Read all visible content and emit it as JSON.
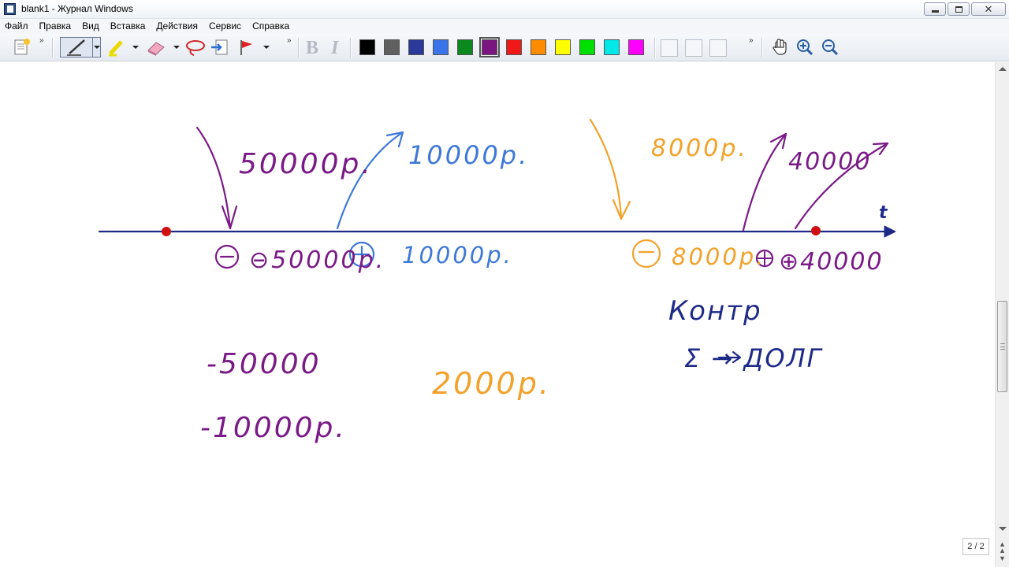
{
  "window": {
    "title": "blank1 - Журнал Windows"
  },
  "menu": [
    "Файл",
    "Правка",
    "Вид",
    "Вставка",
    "Действия",
    "Сервис",
    "Справка"
  ],
  "toolbar": {
    "bold_label": "B",
    "italic_label": "I",
    "colors": [
      "#000000",
      "#606060",
      "#2b3a9b",
      "#3b74e8",
      "#0a8a1e",
      "#7b1580",
      "#f01818",
      "#ff8c00",
      "#ffff00",
      "#00e000",
      "#00e8e8",
      "#ff00ff"
    ],
    "selected_color": "#7b1580"
  },
  "ink_colors": {
    "purple": "#7a1a86",
    "blue": "#3d78d8",
    "orange": "#f2a12a",
    "navy": "#1e2a88",
    "dot": "#d01010"
  },
  "notes": {
    "axis_label": "t",
    "top_labels": [
      "50000р.",
      "10000р.",
      "8000р.",
      "40000"
    ],
    "axis_labels": [
      "⊖50000р.",
      "⊕",
      "10000р.",
      "⊖",
      "8000р.",
      "⊕40000"
    ],
    "lower_left": [
      "-50000",
      "-10000р."
    ],
    "middle": "2000р.",
    "right_notes": [
      "Контр",
      "Σ → ДОЛГ"
    ]
  },
  "page_indicator": "2 / 2"
}
